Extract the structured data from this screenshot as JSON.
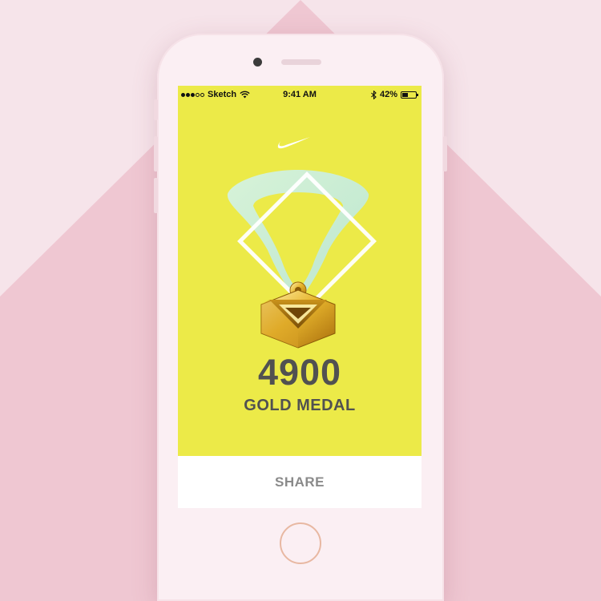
{
  "colors": {
    "backdrop_light": "#f6e4ea",
    "backdrop_pink": "#efc7d2",
    "screen_yellow": "#ecea48",
    "text_gray": "#515151"
  },
  "status_bar": {
    "carrier": "Sketch",
    "time": "9:41 AM",
    "battery": "42%",
    "battery_level": 0.42
  },
  "brand": {
    "logo": "nike-swoosh-icon"
  },
  "achievement": {
    "score": "4900",
    "medal": "GOLD MEDAL"
  },
  "actions": {
    "share_label": "SHARE"
  }
}
